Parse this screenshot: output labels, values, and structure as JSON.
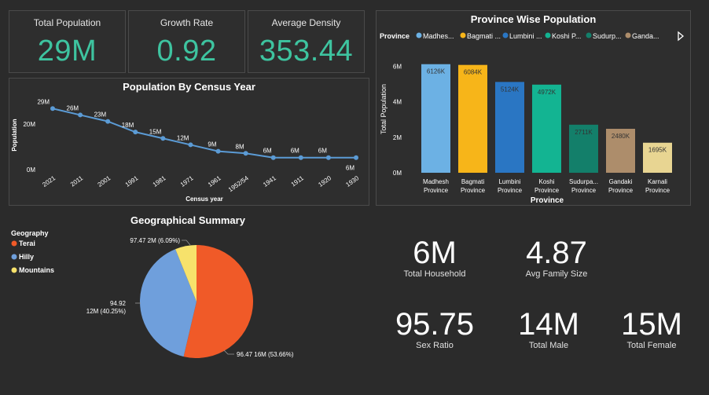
{
  "kpis": [
    {
      "label": "Total Population",
      "value": "29M"
    },
    {
      "label": "Growth Rate",
      "value": "0.92"
    },
    {
      "label": "Average Density",
      "value": "353.44"
    }
  ],
  "stats": {
    "household_value": "6M",
    "household_label": "Total Household",
    "family_value": "4.87",
    "family_label": "Avg Family Size",
    "sexratio_value": "95.75",
    "sexratio_label": "Sex Ratio",
    "male_value": "14M",
    "male_label": "Total Male",
    "female_value": "15M",
    "female_label": "Total Female"
  },
  "colors": {
    "accent": "#3ec4a0",
    "line": "#5b9bd5"
  },
  "chart_data": [
    {
      "type": "line",
      "title": "Population By Census Year",
      "xlabel": "Census year",
      "ylabel": "Population",
      "y_ticks": [
        "20M",
        "0M"
      ],
      "x": [
        "2021",
        "2011",
        "2001",
        "1991",
        "1981",
        "1971",
        "1961",
        "1952/54",
        "1941",
        "1911",
        "1920",
        "1930"
      ],
      "values": [
        29,
        26,
        23,
        18,
        15,
        12,
        9,
        8,
        6,
        6,
        6,
        6
      ],
      "labels": [
        "29M",
        "26M",
        "23M",
        "18M",
        "15M",
        "12M",
        "9M",
        "8M",
        "6M",
        "6M",
        "6M",
        "6M"
      ],
      "ylim": [
        0,
        35
      ]
    },
    {
      "type": "bar",
      "title": "Province Wise Population",
      "legend_title": "Province",
      "legend": [
        {
          "name": "Madhes...",
          "color": "#6cb1e4"
        },
        {
          "name": "Bagmati ...",
          "color": "#f7b519"
        },
        {
          "name": "Lumbini ...",
          "color": "#2a76c3"
        },
        {
          "name": "Koshi P...",
          "color": "#13b492"
        },
        {
          "name": "Sudurp...",
          "color": "#137f6a"
        },
        {
          "name": "Ganda...",
          "color": "#ad8d6b"
        }
      ],
      "xlabel": "Province",
      "ylabel": "Total Population",
      "y_ticks": [
        "6M",
        "4M",
        "2M",
        "0M"
      ],
      "categories": [
        {
          "line1": "Madhesh",
          "line2": "Province"
        },
        {
          "line1": "Bagmati",
          "line2": "Province"
        },
        {
          "line1": "Lumbini",
          "line2": "Province"
        },
        {
          "line1": "Koshi",
          "line2": "Province"
        },
        {
          "line1": "Sudurpa...",
          "line2": "Province"
        },
        {
          "line1": "Gandaki",
          "line2": "Province"
        },
        {
          "line1": "Karnali",
          "line2": "Province"
        }
      ],
      "values": [
        6126,
        6084,
        5124,
        4972,
        2711,
        2480,
        1695
      ],
      "labels": [
        "6126K",
        "6084K",
        "5124K",
        "4972K",
        "2711K",
        "2480K",
        "1695K"
      ],
      "colors": [
        "#6cb1e4",
        "#f7b519",
        "#2a76c3",
        "#13b492",
        "#137f6a",
        "#ad8d6b",
        "#e8d592"
      ],
      "ylim": [
        0,
        7000
      ]
    },
    {
      "type": "pie",
      "title": "Geographical Summary",
      "legend_title": "Geography",
      "legend": [
        {
          "name": "Terai",
          "color": "#f05a28"
        },
        {
          "name": "Hilly",
          "color": "#6f9fdc"
        },
        {
          "name": "Mountains",
          "color": "#f7e26b"
        }
      ],
      "slices": [
        {
          "name": "Terai",
          "percent": 53.66,
          "label": "96.47 16M (53.66%)",
          "color": "#f05a28"
        },
        {
          "name": "Hilly",
          "percent": 40.25,
          "label_line1": "94.92",
          "label_line2": "12M (40.25%)",
          "color": "#6f9fdc"
        },
        {
          "name": "Mountains",
          "percent": 6.09,
          "label": "97.47 2M (6.09%)",
          "color": "#f7e26b"
        }
      ]
    }
  ]
}
